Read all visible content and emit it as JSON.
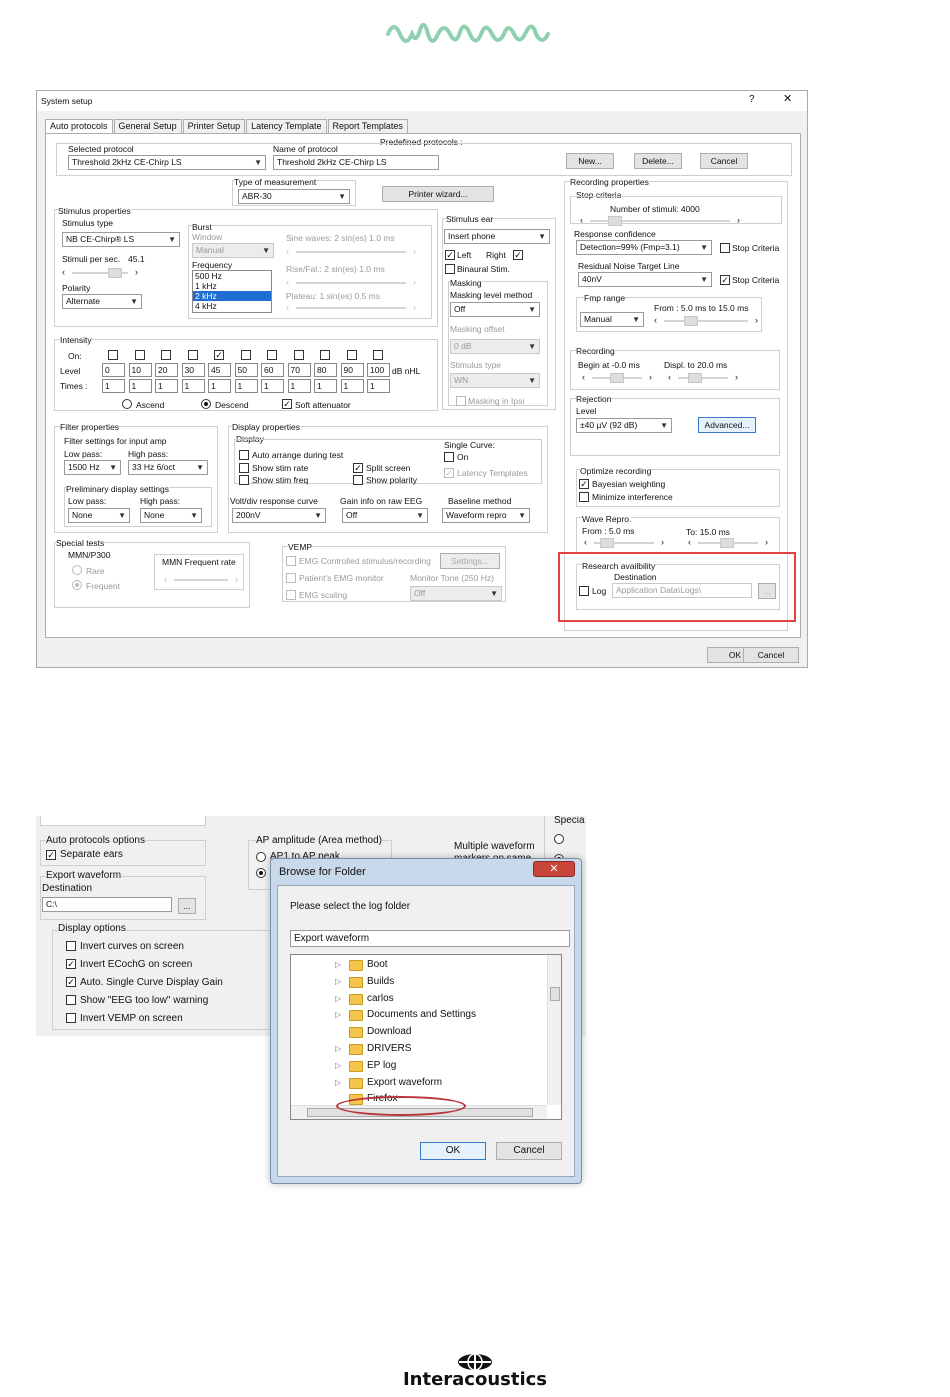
{
  "system_setup": {
    "title": "System setup",
    "help": "?",
    "close": "✕",
    "tabs": [
      "Auto protocols",
      "General Setup",
      "Printer Setup",
      "Latency Template",
      "Report Templates"
    ],
    "predefined_protocols": "Predefined protocols :",
    "selected_protocol_label": "Selected protocol",
    "selected_protocol_value": "Threshold 2kHz CE-Chirp LS",
    "name_of_protocol_label": "Name of protocol",
    "name_of_protocol_value": "Threshold 2kHz CE-Chirp LS",
    "new_btn": "New...",
    "delete_btn": "Delete...",
    "cancel_top_btn": "Cancel",
    "type_of_measurement_label": "Type of measurement",
    "type_of_measurement_value": "ABR-30",
    "printer_wizard_btn": "Printer wizard...",
    "stimulus": {
      "group": "Stimulus properties",
      "type_label": "Stimulus type",
      "type_value": "NB CE-Chirp® LS",
      "rate_label": "Stimuli per sec.",
      "rate_value": "45.1",
      "polarity_label": "Polarity",
      "polarity_value": "Alternate",
      "burst_label": "Burst",
      "window_label": "Window",
      "window_value": "Manual",
      "frequency_label": "Frequency",
      "frequencies": [
        "500 Hz",
        "1 kHz",
        "2 kHz",
        "4 kHz"
      ],
      "sine_label": "Sine waves: 2 sin(es) 1.0 ms",
      "rise_label": "Rise/Fal.: 2 sin(es) 1.0 ms",
      "plateau_label": "Plateau:   1 sin(es) 0.5 ms"
    },
    "stim_ear": {
      "group": "Stimulus ear",
      "transducer": "Insert phone",
      "left": "Left",
      "right": "Right",
      "binaural": "Binaural Stim."
    },
    "masking": {
      "group": "Masking",
      "method_label": "Masking level method",
      "method_value": "Off",
      "offset_label": "Masking offset",
      "offset_value": "0 dB",
      "type_label": "Stimulus type",
      "type_value": "WN",
      "ipsi": "Masking in Ipsi"
    },
    "intensity": {
      "group": "Intensity",
      "on_label": "On:",
      "level_label": "Level",
      "times_label": "Times :",
      "levels": [
        "0",
        "10",
        "20",
        "30",
        "45",
        "50",
        "60",
        "70",
        "80",
        "90",
        "100"
      ],
      "times": [
        "1",
        "1",
        "1",
        "1",
        "1",
        "1",
        "1",
        "1",
        "1",
        "1",
        "1"
      ],
      "unit": "dB nHL",
      "ascend": "Ascend",
      "descend": "Descend",
      "soft_att": "Soft attenuator"
    },
    "filter": {
      "group": "Filter properties",
      "settings_label": "Filter settings for input amp",
      "low_pass_label": "Low pass:",
      "low_pass_value": "1500 Hz",
      "high_pass_label": "High pass:",
      "high_pass_value": "33 Hz 6/oct",
      "prelim_label": "Preliminary display settings",
      "pre_low_label": "Low pass:",
      "pre_low_value": "None",
      "pre_high_label": "High pass:",
      "pre_high_value": "None"
    },
    "display": {
      "group": "Display properties",
      "display_label": "Display",
      "auto_arrange": "Auto arrange during test",
      "show_stim_rate": "Show stim rate",
      "show_stim_freq": "Show stim freq",
      "split_screen": "Split screen",
      "show_polarity": "Show polarity",
      "single_curve_label": "Single Curve:",
      "single_on": "On",
      "latency_templates": "Latency Templates",
      "volt_label": "Volt/div response curve",
      "volt_value": "200nV",
      "gain_label": "Gain info on raw EEG",
      "gain_value": "Off",
      "baseline_label": "Baseline method",
      "baseline_value": "Waveform repro"
    },
    "special": {
      "group": "Special tests",
      "mmn_label": "MMN/P300",
      "rare": "Rare",
      "frequent": "Frequent",
      "mmn_rate_label": "MMN Frequent rate"
    },
    "vemp": {
      "group": "VEMP",
      "emg_controlled": "EMG Controlled stimulus/recording",
      "settings_btn": "Settings...",
      "patient_emg": "Patient's EMG monitor",
      "monitor_tone": "Monitor Tone (250 Hz)",
      "emg_scaling": "EMG scaling",
      "monitor_value": "Off"
    },
    "recording_props": {
      "group": "Recording properties",
      "stop_criteria": "Stop criteria",
      "num_stimuli": "Number of stimuli:  4000",
      "response_conf_label": "Response confidence",
      "response_conf_value": "Detection=99% (Fmp=3.1)",
      "stop_crit_cb": "Stop Criteria",
      "residual_label": "Residual Noise Target Line",
      "residual_value": "40nV",
      "stop_crit_cb2": "Stop Criteria",
      "fmp_range": "Fmp range",
      "fmp_value": "Manual",
      "fmp_from_to": "From : 5.0 ms to  15.0 ms",
      "recording_label": "Recording",
      "begin_at": "Begin at  -0.0 ms",
      "displ_to": "Displ. to   20.0 ms",
      "rejection_label": "Rejection",
      "level_label": "Level",
      "level_value": "±40 µV (92 dB)",
      "advanced_btn": "Advanced...",
      "optimize_label": "Optimize recording",
      "bayesian": "Bayesian weighting",
      "minimize": "Minimize interference",
      "wave_repro": "Wave Repro.",
      "wave_from": "From : 5.0 ms",
      "wave_to": "To:   15.0 ms",
      "research_label": "Research availbility",
      "destination_label": "Destination",
      "log_label": "Log",
      "destination_value": "Application Data\\Logs\\",
      "browse_btn": "..."
    },
    "ok_btn": "OK",
    "cancel_btn": "Cancel"
  },
  "second": {
    "auto_options": "Auto protocols options",
    "separate_ears": "Separate ears",
    "export_waveform": "Export waveform",
    "destination": "Destination",
    "dest_value": "C:\\",
    "browse": "...",
    "display_options": "Display options",
    "options": [
      "Invert curves on screen",
      "Invert ECochG on screen",
      "Auto. Single Curve Display Gain",
      "Show \"EEG too low\" warning",
      "Invert VEMP on screen"
    ],
    "ap_amplitude": "AP amplitude (Area method)",
    "ap_option": "AP1 to AP peak",
    "multiple_waveform": "Multiple waveform",
    "multiple_sub": "markers on same",
    "special": "Specia"
  },
  "browse_dialog": {
    "title": "Browse for Folder",
    "close": "✕",
    "prompt": "Please select the log folder",
    "path": "Export waveform",
    "folders": [
      "Boot",
      "Builds",
      "carlos",
      "Documents and Settings",
      "Download",
      "DRIVERS",
      "EP log",
      "Export waveform",
      "Firefox"
    ],
    "ok": "OK",
    "cancel": "Cancel"
  },
  "footer": {
    "brand": "Interacoustics"
  },
  "colors": {
    "logo_green": "#8fd0b0",
    "highlight_red": "#e3403f",
    "selection_blue": "#1f6fd1"
  }
}
